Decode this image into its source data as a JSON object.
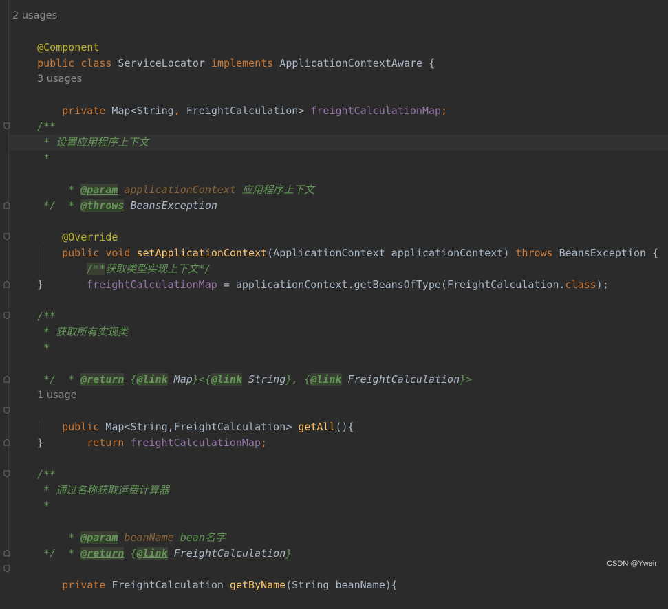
{
  "editor": {
    "hint_usages_class": "2 usages",
    "l_component": "@Component",
    "l_class": {
      "kw": "public class ",
      "name": "ServiceLocator ",
      "impl": "implements ",
      "iface": "ApplicationContextAware {"
    },
    "hint_usages_field": "3 usages",
    "l_field": {
      "kw": "private ",
      "type": "Map<String",
      "comma": ", ",
      "type2": "FreightCalculation> ",
      "name": "freightCalculationMap",
      "semi": ";"
    },
    "doc1": {
      "open": "/**",
      "desc": " * 设置应用程序上下文",
      "blank": " *",
      "param_prefix": " * ",
      "param_tag": "@param",
      "param_name": " applicationContext ",
      "param_desc": "应用程序上下文",
      "throws_prefix": " * ",
      "throws_tag": "@throws",
      "throws_type": " BeansException",
      "close": " */"
    },
    "l_override": "@Override",
    "l_setctx": {
      "kw": "public void ",
      "name": "setApplicationContext",
      "args": "(ApplicationContext applicationContext) ",
      "throws": "throws ",
      "exc": "BeansException {"
    },
    "l_inline_comment": {
      "open": "/**",
      "text": "获取类型实现上下文*/"
    },
    "l_assign": {
      "field": "freightCalculationMap",
      "rest": " = applicationContext.getBeansOfType(FreightCalculation.",
      "cls": "class",
      "end": ");"
    },
    "l_close1": "}",
    "doc2": {
      "open": "/**",
      "desc": " * 获取所有实现类",
      "blank": " *",
      "prefix": " * ",
      "return_tag": "@return",
      "p1": " {",
      "link1": "@link",
      "t1": " Map",
      "p2": "}<{",
      "link2": "@link",
      "t2": " String",
      "p3": "}, {",
      "link3": "@link",
      "t3": " FreightCalculation",
      "p4": "}>",
      "close": " */"
    },
    "hint_usage_getall": "1 usage",
    "l_getall": {
      "kw": "public ",
      "type": "Map<String,FreightCalculation> ",
      "name": "getAll",
      "rest": "(){"
    },
    "l_return": {
      "kw": "return ",
      "field": "freightCalculationMap",
      "semi": ";"
    },
    "l_close2": "}",
    "doc3": {
      "open": "/**",
      "desc": " * 通过名称获取运费计算器",
      "blank": " *",
      "prefix": " * ",
      "param_tag": "@param",
      "param_name": " beanName ",
      "param_desc": "bean名字",
      "return_tag": "@return",
      "p1": " {",
      "link": "@link",
      "t1": " FreightCalculation",
      "p2": "}",
      "close": " */"
    },
    "l_getbyname": {
      "kw": "private ",
      "type": "FreightCalculation ",
      "name": "getByName",
      "rest": "(String beanName){"
    }
  },
  "watermark": "CSDN @Yweir",
  "colors": {
    "background": "#2b2b2b",
    "keyword": "#cc7832",
    "annotation": "#bbb529",
    "field": "#9876aa",
    "method": "#ffc66d",
    "doc_comment": "#629755"
  }
}
